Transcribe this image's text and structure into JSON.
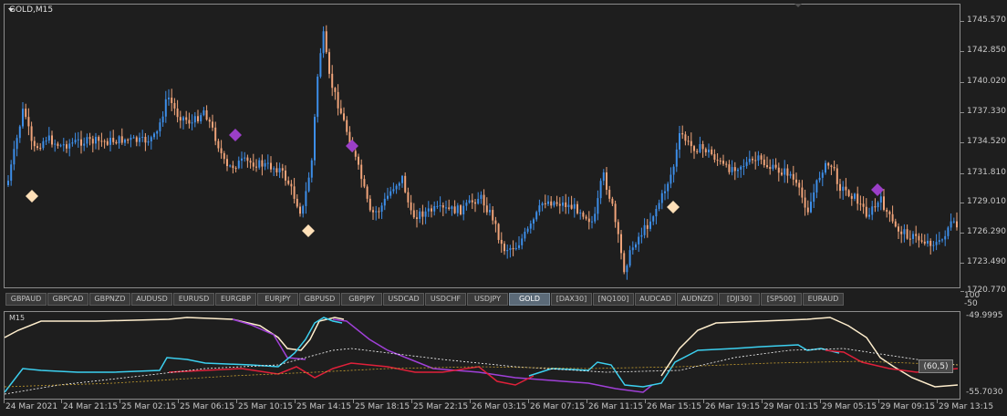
{
  "chart": {
    "title": "GOLD,M15",
    "indicator_title": "M15",
    "indicator_badge": "(60,5)",
    "price_axis": [
      "1745.570",
      "1742.850",
      "1740.020",
      "1737.330",
      "1734.520",
      "1731.810",
      "1729.010",
      "1726.290",
      "1723.490",
      "1720.770"
    ],
    "indicator_axis": {
      "top": "100",
      "mid1": "-50",
      "level_high": "-49.9995",
      "level_low": "-55.7030"
    },
    "time_axis": [
      "24 Mar 2021",
      "24 Mar 21:15",
      "25 Mar 02:15",
      "25 Mar 06:15",
      "25 Mar 10:15",
      "25 Mar 14:15",
      "25 Mar 18:15",
      "25 Mar 22:15",
      "26 Mar 03:15",
      "26 Mar 07:15",
      "26 Mar 11:15",
      "26 Mar 15:15",
      "26 Mar 19:15",
      "29 Mar 01:15",
      "29 Mar 05:15",
      "29 Mar 09:15",
      "29 Mar 13:15"
    ]
  },
  "symbols": [
    {
      "label": "GBPAUD"
    },
    {
      "label": "GBPCAD"
    },
    {
      "label": "GBPNZD"
    },
    {
      "label": "AUDUSD"
    },
    {
      "label": "EURUSD"
    },
    {
      "label": "EURGBP"
    },
    {
      "label": "EURJPY"
    },
    {
      "label": "GBPUSD"
    },
    {
      "label": "GBPJPY"
    },
    {
      "label": "USDCAD"
    },
    {
      "label": "USDCHF"
    },
    {
      "label": "USDJPY"
    },
    {
      "label": "GOLD",
      "active": true
    },
    {
      "label": "[DAX30]"
    },
    {
      "label": "[NQ100]"
    },
    {
      "label": "AUDCAD"
    },
    {
      "label": "AUDNZD"
    },
    {
      "label": "[DJI30]"
    },
    {
      "label": "[SP500]"
    },
    {
      "label": "EURAUD"
    }
  ],
  "colors": {
    "bull_candle": "#3d8ee8",
    "bear_candle": "#f0a47a",
    "marker_peach": "#ffe0b8",
    "marker_purple": "#9b3fc8",
    "ind_cream": "#ffeecd",
    "ind_purple": "#a040d8",
    "ind_cyan": "#3cd0f0",
    "ind_red": "#e0203a",
    "ind_white_dash": "#ffffff",
    "ind_gold_dash": "#c8a030"
  }
}
